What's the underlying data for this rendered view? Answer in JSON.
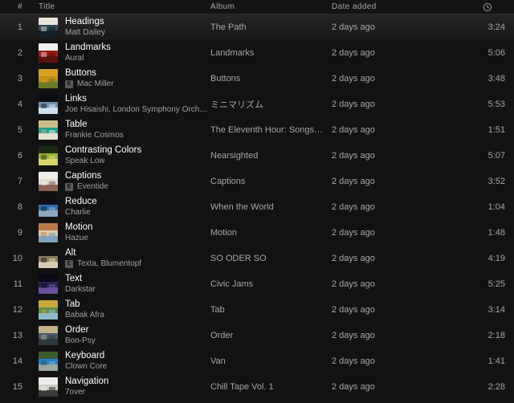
{
  "header": {
    "index": "#",
    "title": "Title",
    "album": "Album",
    "date_added": "Date added",
    "duration_icon": "clock-icon"
  },
  "colors": {
    "background": "#121212",
    "row_hover": "#262626",
    "text_primary": "#ffffff",
    "text_secondary": "#a7a7a7"
  },
  "tracks": [
    {
      "index": "1",
      "title": "Headings",
      "artist": "Matt Dailey",
      "explicit": false,
      "album": "The Path",
      "date_added": "2 days ago",
      "duration": "3:24",
      "art": [
        "#e8e4dc",
        "#2d4a52",
        "#162028"
      ]
    },
    {
      "index": "2",
      "title": "Landmarks",
      "artist": "Aural",
      "explicit": false,
      "album": "Landmarks",
      "date_added": "2 days ago",
      "duration": "5:06",
      "art": [
        "#f2f0ec",
        "#9c1c18",
        "#5e0f0c"
      ]
    },
    {
      "index": "3",
      "title": "Buttons",
      "artist": "Mac Miller",
      "explicit": true,
      "album": "Buttons",
      "date_added": "2 days ago",
      "duration": "3:48",
      "art": [
        "#d9a022",
        "#c28f18",
        "#6d7a28"
      ]
    },
    {
      "index": "4",
      "title": "Links",
      "artist": "Joe Hisaishi, London Symphony Orchestra",
      "explicit": false,
      "album": "ミニマリズム",
      "date_added": "2 days ago",
      "duration": "5:53",
      "art": [
        "#0a0d14",
        "#6f8fae",
        "#cfe0ef"
      ]
    },
    {
      "index": "5",
      "title": "Table",
      "artist": "Frankie Cosmos",
      "explicit": false,
      "album": "The Eleventh Hour: Songs for Climate ...",
      "date_added": "2 days ago",
      "duration": "1:51",
      "art": [
        "#cdbd8a",
        "#1f9e92",
        "#e8e2d0"
      ]
    },
    {
      "index": "6",
      "title": "Contrasting Colors",
      "artist": "Speak Low",
      "explicit": false,
      "album": "Nearsighted",
      "date_added": "2 days ago",
      "duration": "5:07",
      "art": [
        "#1d2a14",
        "#9bb03a",
        "#d8d46a"
      ]
    },
    {
      "index": "7",
      "title": "Captions",
      "artist": "Eventide",
      "explicit": true,
      "album": "Captions",
      "date_added": "2 days ago",
      "duration": "3:52",
      "art": [
        "#f1eeea",
        "#ded8d2",
        "#8c6456"
      ]
    },
    {
      "index": "8",
      "title": "Reduce",
      "artist": "Charlie",
      "explicit": false,
      "album": "When the World",
      "date_added": "2 days ago",
      "duration": "1:04",
      "art": [
        "#0d1018",
        "#2f6fa8",
        "#8fa6bc"
      ]
    },
    {
      "index": "9",
      "title": "Motion",
      "artist": "Hazue",
      "explicit": false,
      "album": "Motion",
      "date_added": "2 days ago",
      "duration": "1:48",
      "art": [
        "#b87a4a",
        "#d9c9b0",
        "#7fa2bd"
      ]
    },
    {
      "index": "10",
      "title": "Alt",
      "artist": "Texta, Blumentopf",
      "explicit": true,
      "album": "SO ODER SO",
      "date_added": "2 days ago",
      "duration": "4:19",
      "art": [
        "#141210",
        "#8a7c5e",
        "#d6cdb4"
      ]
    },
    {
      "index": "11",
      "title": "Text",
      "artist": "Darkstar",
      "explicit": false,
      "album": "Civic Jams",
      "date_added": "2 days ago",
      "duration": "5:25",
      "art": [
        "#0c0a16",
        "#2a2250",
        "#6b4f9e"
      ]
    },
    {
      "index": "12",
      "title": "Tab",
      "artist": "Babak Afra",
      "explicit": false,
      "album": "Tab",
      "date_added": "2 days ago",
      "duration": "3:14",
      "art": [
        "#c9a93c",
        "#5f8a4a",
        "#8fb8cc"
      ]
    },
    {
      "index": "13",
      "title": "Order",
      "artist": "Bon-Psy",
      "explicit": false,
      "album": "Order",
      "date_added": "2 days ago",
      "duration": "2:18",
      "art": [
        "#c2b184",
        "#4a5a6a",
        "#2c3a3e"
      ]
    },
    {
      "index": "14",
      "title": "Keyboard",
      "artist": "Clown Core",
      "explicit": false,
      "album": "Van",
      "date_added": "2 days ago",
      "duration": "1:41",
      "art": [
        "#3d5a2c",
        "#1f7fd0",
        "#9aa8a0"
      ]
    },
    {
      "index": "15",
      "title": "Navigation",
      "artist": "7over",
      "explicit": false,
      "album": "Chill Tape Vol. 1",
      "date_added": "2 days ago",
      "duration": "2:28",
      "art": [
        "#ecebe7",
        "#cfcdc6",
        "#3a3a38"
      ]
    }
  ]
}
